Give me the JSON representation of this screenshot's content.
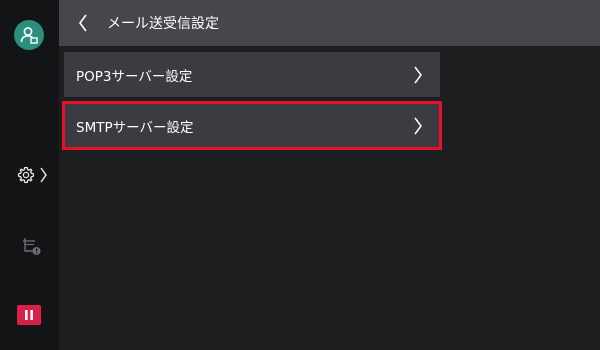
{
  "header": {
    "title": "メール送受信設定",
    "back_icon": "chevron-left-icon"
  },
  "rail": {
    "avatar_icon": "user-avatar-icon",
    "avatar_color": "#2a8f7d",
    "settings_icon": "gear-icon",
    "job_icon": "printer-status-icon",
    "pause_icon": "pause-icon",
    "pause_color": "#d8204b"
  },
  "menu": {
    "items": [
      {
        "label": "POP3サーバー設定",
        "selected": false
      },
      {
        "label": "SMTPサーバー設定",
        "selected": true
      }
    ],
    "selection_color": "#e8102b"
  }
}
